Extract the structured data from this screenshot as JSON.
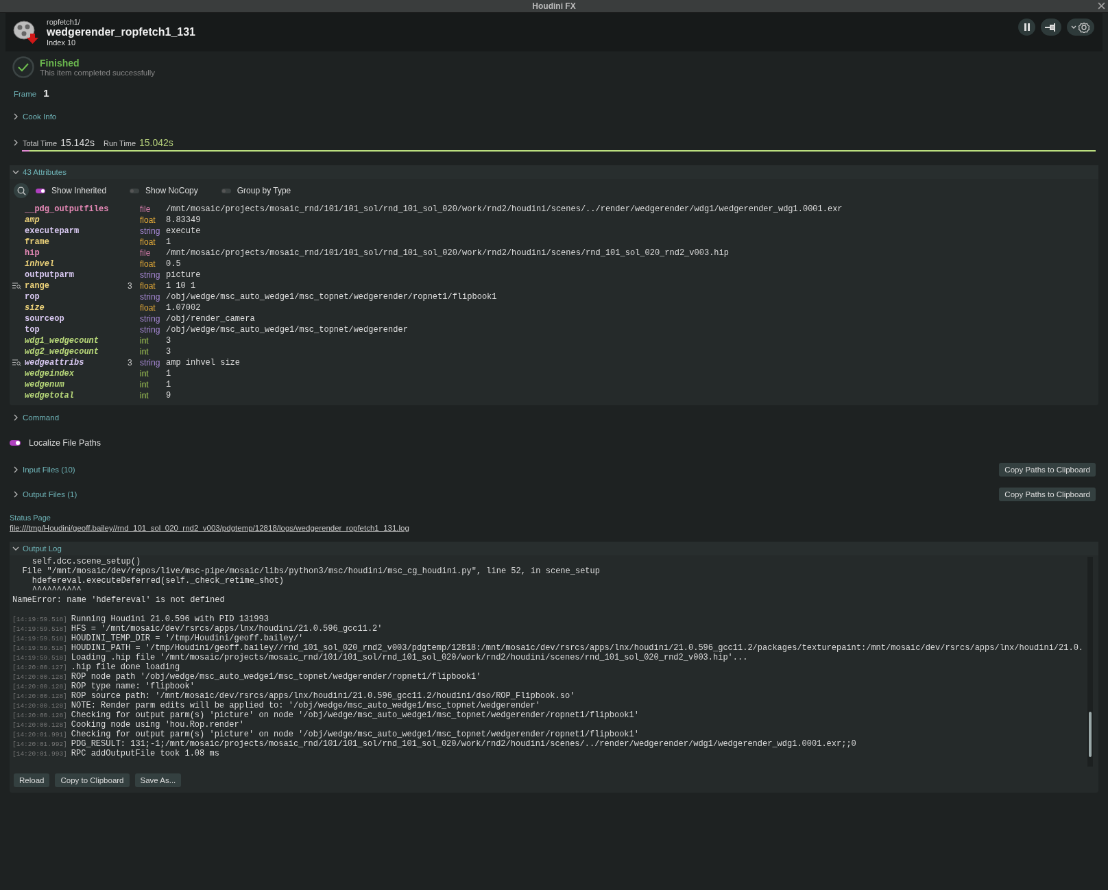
{
  "window": {
    "title": "Houdini FX"
  },
  "header": {
    "path": "ropfetch1/",
    "name": "wedgerender_ropfetch1_131",
    "index": "Index 10"
  },
  "status": {
    "title": "Finished",
    "message": "This item completed successfully"
  },
  "frame": {
    "label": "Frame",
    "value": "1"
  },
  "cook_info": {
    "label": "Cook Info",
    "expanded": false
  },
  "times": {
    "expanded": false,
    "total_label": "Total Time",
    "total": "15.142s",
    "run_label": "Run Time",
    "run": "15.042s",
    "level": 0.993
  },
  "attributes": {
    "label": "43 Attributes",
    "expanded": true,
    "toggles": [
      {
        "label": "Show Inherited",
        "on": true
      },
      {
        "label": "Show NoCopy",
        "on": false
      },
      {
        "label": "Group by Type",
        "on": false
      }
    ],
    "rows": [
      {
        "name": "__pdg_outputfiles",
        "kind": "file",
        "type": "file",
        "inherited": false,
        "value": "/mnt/mosaic/projects/mosaic_rnd/101/101_sol/rnd_101_sol_020/work/rnd2/houdini/scenes/../render/wedgerender/wdg1/wedgerender_wdg1.0001.exr"
      },
      {
        "name": "amp",
        "kind": "float",
        "type": "float",
        "inherited": true,
        "value": "8.83349"
      },
      {
        "name": "executeparm",
        "kind": "string",
        "type": "string",
        "inherited": false,
        "value": "execute"
      },
      {
        "name": "frame",
        "kind": "float",
        "type": "float",
        "inherited": false,
        "value": "1"
      },
      {
        "name": "hip",
        "kind": "file",
        "type": "file",
        "inherited": false,
        "value": "/mnt/mosaic/projects/mosaic_rnd/101/101_sol/rnd_101_sol_020/work/rnd2/houdini/scenes/rnd_101_sol_020_rnd2_v003.hip"
      },
      {
        "name": "inhvel",
        "kind": "float",
        "type": "float",
        "inherited": true,
        "value": "0.5"
      },
      {
        "name": "outputparm",
        "kind": "string",
        "type": "string",
        "inherited": false,
        "value": "picture"
      },
      {
        "name": "range",
        "kind": "float",
        "type": "float",
        "inherited": false,
        "count": "3",
        "value": "1 10 1"
      },
      {
        "name": "rop",
        "kind": "string",
        "type": "string",
        "inherited": false,
        "value": "/obj/wedge/msc_auto_wedge1/msc_topnet/wedgerender/ropnet1/flipbook1"
      },
      {
        "name": "size",
        "kind": "float",
        "type": "float",
        "inherited": true,
        "value": "1.07002"
      },
      {
        "name": "sourceop",
        "kind": "string",
        "type": "string",
        "inherited": false,
        "value": "/obj/render_camera"
      },
      {
        "name": "top",
        "kind": "string",
        "type": "string",
        "inherited": false,
        "value": "/obj/wedge/msc_auto_wedge1/msc_topnet/wedgerender"
      },
      {
        "name": "wdg1_wedgecount",
        "kind": "int",
        "type": "int",
        "inherited": true,
        "value": "3"
      },
      {
        "name": "wdg2_wedgecount",
        "kind": "int",
        "type": "int",
        "inherited": true,
        "value": "3"
      },
      {
        "name": "wedgeattribs",
        "kind": "string",
        "type": "string",
        "inherited": true,
        "count": "3",
        "value": "amp inhvel size"
      },
      {
        "name": "wedgeindex",
        "kind": "int",
        "type": "int",
        "inherited": true,
        "value": "1"
      },
      {
        "name": "wedgenum",
        "kind": "int",
        "type": "int",
        "inherited": true,
        "value": "1"
      },
      {
        "name": "wedgetotal",
        "kind": "int",
        "type": "int",
        "inherited": true,
        "value": "9"
      }
    ]
  },
  "command": {
    "label": "Command",
    "expanded": false
  },
  "localize": {
    "label": "Localize File Paths",
    "on": true
  },
  "file_sections": [
    {
      "label": "Input Files (10)",
      "expanded": false,
      "button": "Copy Paths to Clipboard"
    },
    {
      "label": "Output Files (1)",
      "expanded": false,
      "button": "Copy Paths to Clipboard"
    }
  ],
  "status_page": {
    "label": "Status Page",
    "link": "file:///tmp/Houdini/geoff.bailey//rnd_101_sol_020_rnd2_v003/pdgtemp/12818/logs/wedgerender_ropfetch1_131.log"
  },
  "output_log": {
    "label": "Output Log",
    "expanded": true,
    "lines": [
      {
        "kind": "trace",
        "text": "    self.dcc.scene_setup()"
      },
      {
        "kind": "trace",
        "text": "  File \"/mnt/mosaic/dev/repos/live/msc-pipe/mosaic/libs/python3/msc/houdini/msc_cg_houdini.py\", line 52, in scene_setup"
      },
      {
        "kind": "trace",
        "text": "    hdefereval.executeDeferred(self._check_retime_shot)"
      },
      {
        "kind": "trace",
        "text": "    ^^^^^^^^^^"
      },
      {
        "kind": "trace",
        "text": "NameError: name 'hdefereval' is not defined"
      },
      {
        "kind": "entry",
        "time": "[14:19:59.518]",
        "text": "Running Houdini 21.0.596 with PID 131993"
      },
      {
        "kind": "entry",
        "time": "[14:19:59.518]",
        "text": "HFS = '/mnt/mosaic/dev/rsrcs/apps/lnx/houdini/21.0.596_gcc11.2'"
      },
      {
        "kind": "entry",
        "time": "[14:19:59.518]",
        "text": "HOUDINI_TEMP_DIR = '/tmp/Houdini/geoff.bailey/'"
      },
      {
        "kind": "entry",
        "time": "[14:19:59.518]",
        "text": "HOUDINI_PATH = '/tmp/Houdini/geoff.bailey//rnd_101_sol_020_rnd2_v003/pdgtemp/12818:/mnt/mosaic/dev/rsrcs/apps/lnx/houdini/21.0.596_gcc11.2/packages/texturepaint:/mnt/mosaic/dev/rsrcs/apps/lnx/houdini/21.0."
      },
      {
        "kind": "entry",
        "time": "[14:19:59.518]",
        "text": "Loading .hip file '/mnt/mosaic/projects/mosaic_rnd/101/101_sol/rnd_101_sol_020/work/rnd2/houdini/scenes/rnd_101_sol_020_rnd2_v003.hip'..."
      },
      {
        "kind": "entry",
        "time": "[14:20:00.127]",
        "text": ".hip file done loading"
      },
      {
        "kind": "entry",
        "time": "[14:20:00.128]",
        "text": "ROP node path '/obj/wedge/msc_auto_wedge1/msc_topnet/wedgerender/ropnet1/flipbook1'"
      },
      {
        "kind": "entry",
        "time": "[14:20:00.128]",
        "text": "ROP type name: 'flipbook'"
      },
      {
        "kind": "entry",
        "time": "[14:20:00.128]",
        "text": "ROP source path: '/mnt/mosaic/dev/rsrcs/apps/lnx/houdini/21.0.596_gcc11.2/houdini/dso/ROP_Flipbook.so'"
      },
      {
        "kind": "entry",
        "time": "[14:20:00.128]",
        "text": "NOTE: Render parm edits will be applied to: '/obj/wedge/msc_auto_wedge1/msc_topnet/wedgerender'"
      },
      {
        "kind": "entry",
        "time": "[14:20:00.128]",
        "text": "Checking for output parm(s) 'picture' on node '/obj/wedge/msc_auto_wedge1/msc_topnet/wedgerender/ropnet1/flipbook1'"
      },
      {
        "kind": "entry",
        "time": "[14:20:00.128]",
        "text": "Cooking node using 'hou.Rop.render'"
      },
      {
        "kind": "entry",
        "time": "[14:20:01.991]",
        "text": "Checking for output parm(s) 'picture' on node '/obj/wedge/msc_auto_wedge1/msc_topnet/wedgerender/ropnet1/flipbook1'"
      },
      {
        "kind": "entry",
        "time": "[14:20:01.992]",
        "text": "PDG_RESULT: 131;-1;/mnt/mosaic/projects/mosaic_rnd/101/101_sol/rnd_101_sol_020/work/rnd2/houdini/scenes/../render/wedgerender/wdg1/wedgerender_wdg1.0001.exr;;0"
      },
      {
        "kind": "entry",
        "time": "[14:20:01.993]",
        "text": "RPC addOutputFile took 1.08 ms"
      }
    ],
    "buttons": [
      "Reload",
      "Copy to Clipboard",
      "Save As..."
    ]
  }
}
